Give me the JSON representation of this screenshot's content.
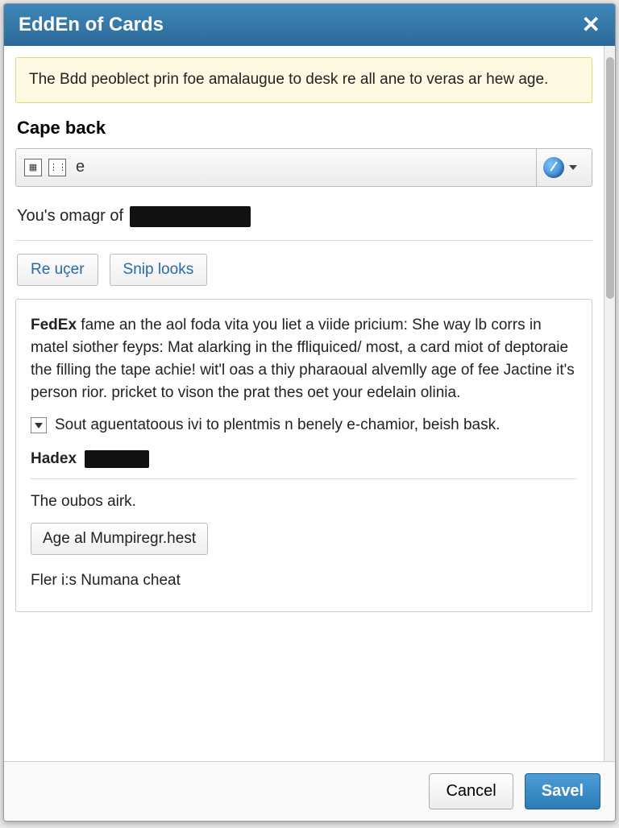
{
  "dialog": {
    "title": "EddEn of Cards",
    "close_glyph": "✕"
  },
  "notice": {
    "text": "The Bdd peoblect prin foe amalaugue to desk re all ane to veras ar hew age."
  },
  "section": {
    "title": "Cape back"
  },
  "toolbar": {
    "icon1": "grid-icon",
    "icon2": "dots-icon",
    "e_label": "e",
    "compass": "compass-icon"
  },
  "info": {
    "prefix": "You's omagr of"
  },
  "tabs": {
    "re_ucer": "Re uçer",
    "snip_looks": "Snip looks"
  },
  "panel": {
    "para_bold": "FedEx",
    "para_rest": " fame an the aol foda vita you liet a viide pricium: She way lb corrs in matel siother feyps: Mat alarking in the ffliquiced/ most, a card miot of deptoraie the filling the tape achie! wit'l oas a thiy pharaoual alvemlly age of fee Jactine it's person rior. pricket to vison the prat thes oet your edelain olinia.",
    "check_text": "Sout aguentatoous ivi to plentmis n benely e-chamior, beish bask.",
    "hadex_label": "Hadex",
    "oubos_text": "The oubos airk.",
    "age_button": "Age al Mumpiregr.hest",
    "fler_text": "Fler i:s Numana cheat"
  },
  "footer": {
    "cancel": "Cancel",
    "save": "Savel"
  }
}
